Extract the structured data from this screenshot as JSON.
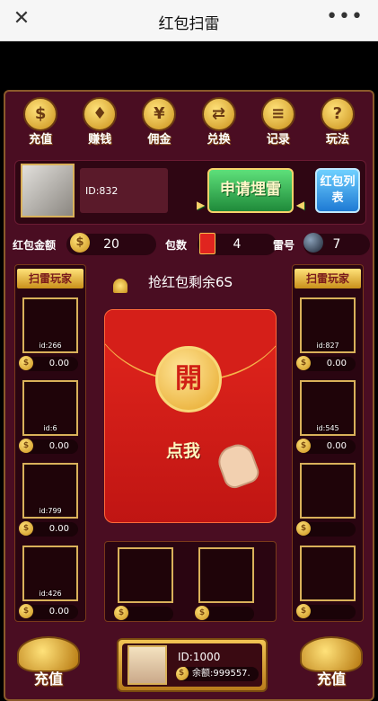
{
  "topbar": {
    "title": "红包扫雷",
    "close_icon": "close-icon",
    "more_icon": "more-icon"
  },
  "menu": [
    {
      "label": "充值",
      "icon": "coins-icon",
      "glyph": "$"
    },
    {
      "label": "赚钱",
      "icon": "gift-icon",
      "glyph": "♦"
    },
    {
      "label": "佣金",
      "icon": "money-bag-icon",
      "glyph": "¥"
    },
    {
      "label": "兑换",
      "icon": "exchange-icon",
      "glyph": "⇄"
    },
    {
      "label": "记录",
      "icon": "record-icon",
      "glyph": "≡"
    },
    {
      "label": "玩法",
      "icon": "help-icon",
      "glyph": "?"
    }
  ],
  "user": {
    "id": "ID:832"
  },
  "buttons": {
    "apply_banker": "申请埋雷",
    "packet_list": "红包列表"
  },
  "stats": {
    "amount_label": "红包金额",
    "amount_value": "20",
    "count_label": "包数",
    "count_value": "4",
    "mine_label": "雷号",
    "mine_value": "7"
  },
  "left_panel": {
    "title": "扫雷玩家",
    "players": [
      {
        "id": "id:266",
        "amount": "0.00"
      },
      {
        "id": "id:6",
        "amount": "0.00"
      },
      {
        "id": "id:799",
        "amount": "0.00"
      },
      {
        "id": "id:426",
        "amount": "0.00"
      }
    ]
  },
  "right_panel": {
    "title": "扫雷玩家",
    "players": [
      {
        "id": "id:827",
        "amount": "0.00"
      },
      {
        "id": "id:545",
        "amount": "0.00"
      },
      {
        "id": "",
        "amount": ""
      },
      {
        "id": "",
        "amount": ""
      }
    ]
  },
  "center": {
    "timer_text": "抢红包剩余6S",
    "open_char": "開",
    "tap_text": "点我"
  },
  "footer": {
    "left_label": "充值",
    "right_label": "充值",
    "user_id": "ID:1000",
    "balance": "余额:999557."
  },
  "colors": {
    "background": "#4a0d22",
    "gold": "#d9b15a",
    "packet_red": "#e3261d",
    "button_green": "#1f8a3a",
    "button_blue": "#1e7ad4"
  }
}
